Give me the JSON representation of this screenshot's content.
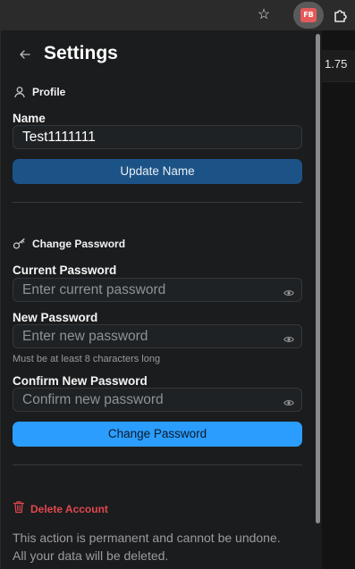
{
  "browser": {
    "extension_badge": "FB"
  },
  "behind_page": {
    "number": "1.75"
  },
  "settings": {
    "title": "Settings",
    "profile": {
      "heading": "Profile",
      "name_label": "Name",
      "name_value": "Test1111111",
      "update_button": "Update Name"
    },
    "password": {
      "heading": "Change Password",
      "current_label": "Current Password",
      "current_placeholder": "Enter current password",
      "new_label": "New Password",
      "new_placeholder": "Enter new password",
      "new_hint": "Must be at least 8 characters long",
      "confirm_label": "Confirm New Password",
      "confirm_placeholder": "Confirm new password",
      "change_button": "Change Password"
    },
    "danger": {
      "heading": "Delete Account",
      "line1": "This action is permanent and cannot be undone.",
      "line2": "All your data will be deleted."
    }
  },
  "colors": {
    "accent": "#2a9dff",
    "update_button": "#1c5387",
    "danger": "#e0474c",
    "panel_bg": "#1b1c1e"
  },
  "icons": {
    "back": "arrow-left-icon",
    "profile": "user-icon",
    "password": "key-icon",
    "visibility": "eye-icon",
    "danger": "trash-icon",
    "bookmark": "star-icon",
    "extensions": "puzzle-icon"
  }
}
